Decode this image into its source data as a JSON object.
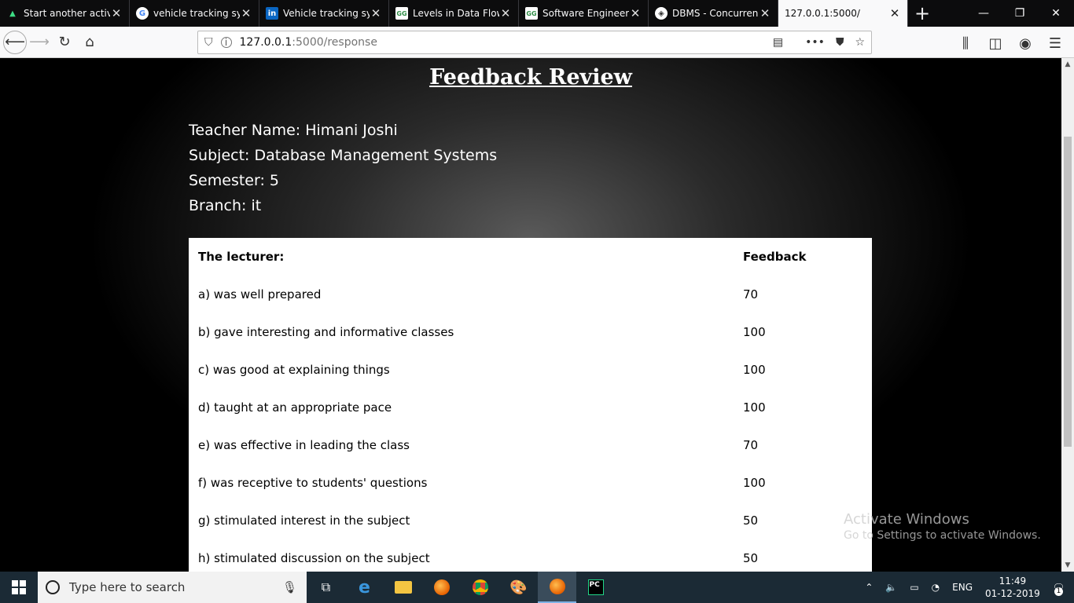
{
  "browser": {
    "tabs": [
      {
        "title": "Start another activit",
        "icon": "android-icon",
        "active": false
      },
      {
        "title": "vehicle tracking syst",
        "icon": "google-icon",
        "active": false
      },
      {
        "title": "Vehicle tracking syst",
        "icon": "linkedin-icon",
        "active": false
      },
      {
        "title": "Levels in Data Flow D",
        "icon": "geeksforgeeks-icon",
        "active": false
      },
      {
        "title": "Software Engineering",
        "icon": "geeksforgeeks-icon",
        "active": false
      },
      {
        "title": "DBMS - Concurrenc",
        "icon": "tutorialspoint-icon",
        "active": false
      },
      {
        "title": "127.0.0.1:5000/",
        "icon": "",
        "active": true
      }
    ],
    "url_host": "127.0.0.1",
    "url_path": ":5000/response"
  },
  "page": {
    "title": "Feedback Review",
    "teacher": "Teacher Name: Himani Joshi",
    "subject": "Subject: Database Management Systems",
    "semester": "Semester: 5",
    "branch": "Branch: it",
    "table": {
      "header": [
        "The lecturer:",
        "Feedback"
      ],
      "rows": [
        [
          "a) was well prepared",
          "70"
        ],
        [
          "b) gave interesting and informative classes",
          "100"
        ],
        [
          "c) was good at explaining things",
          "100"
        ],
        [
          "d) taught at an appropriate pace",
          "100"
        ],
        [
          "e) was effective in leading the class",
          "70"
        ],
        [
          "f) was receptive to students' questions",
          "100"
        ],
        [
          "g) stimulated interest in the subject",
          "50"
        ],
        [
          "h) stimulated discussion on the subject",
          "50"
        ]
      ]
    }
  },
  "watermark": {
    "line1": "Activate Windows",
    "line2": "Go to Settings to activate Windows."
  },
  "taskbar": {
    "search_placeholder": "Type here to search",
    "lang": "ENG",
    "time": "11:49",
    "date": "01-12-2019",
    "notifications": "1"
  }
}
